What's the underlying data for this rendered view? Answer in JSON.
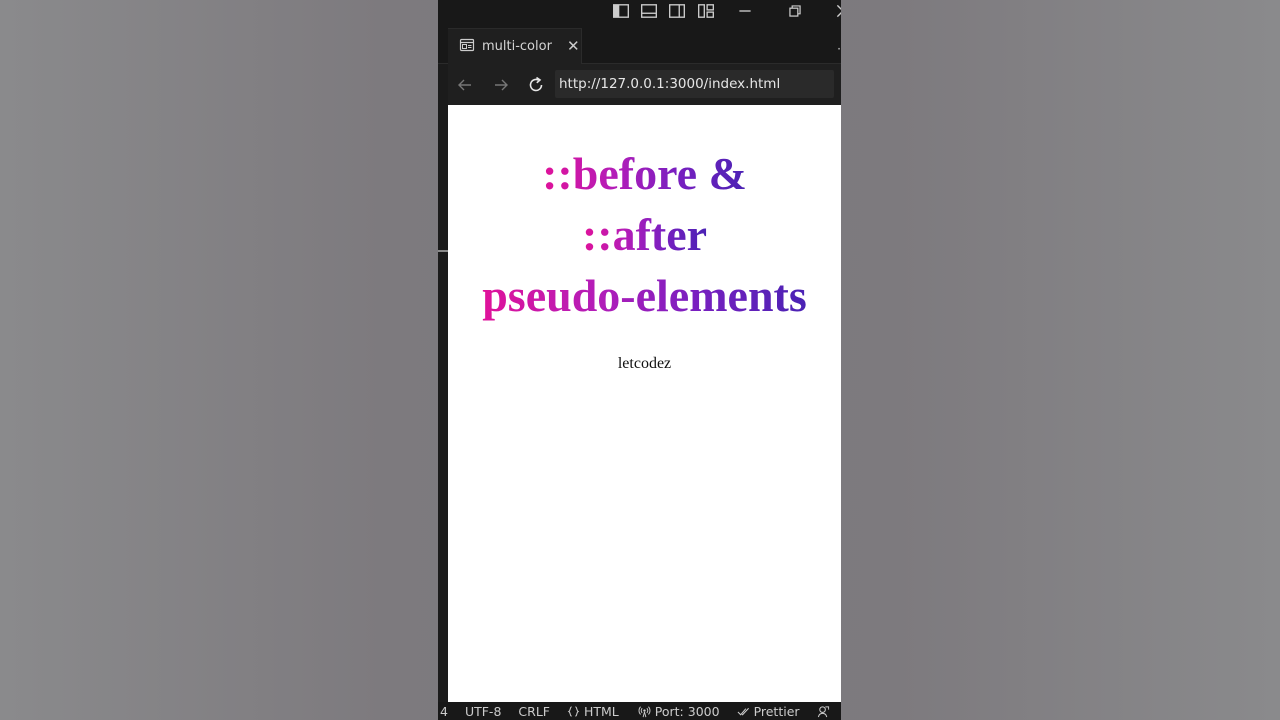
{
  "window": {
    "icons": [
      "toggle-primary-sidebar-icon",
      "toggle-panel-icon",
      "toggle-secondary-sidebar-icon",
      "customize-layout-icon",
      "minimize-icon",
      "restore-icon",
      "close-icon"
    ]
  },
  "tab": {
    "title": "multi-color",
    "icon": "preview-icon",
    "close_glyph": "✕"
  },
  "navigation": {
    "url": "http://127.0.0.1:3000/index.html"
  },
  "page": {
    "heading_lines": [
      "::before &",
      "::after",
      "pseudo-elements"
    ],
    "subtitle": "letcodez",
    "gradient_colors": [
      "#e0129a",
      "#b41db8",
      "#7a1fc0",
      "#4a22b4"
    ]
  },
  "statusbar": {
    "line_fragment": "4",
    "encoding": "UTF-8",
    "eol": "CRLF",
    "language": "HTML",
    "port": "Port: 3000",
    "formatter": "Prettier"
  },
  "colors": {
    "editor_bg": "#1e1e1e",
    "titlebar_bg": "#181818",
    "url_bg": "#2a2a2a",
    "text": "#cccccc"
  }
}
